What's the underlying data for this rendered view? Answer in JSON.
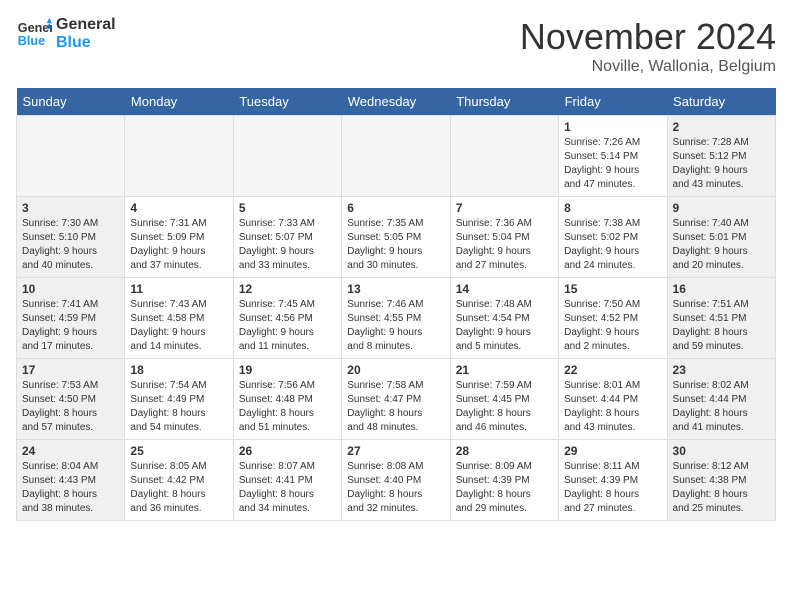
{
  "logo": {
    "line1": "General",
    "line2": "Blue"
  },
  "title": "November 2024",
  "location": "Noville, Wallonia, Belgium",
  "days_of_week": [
    "Sunday",
    "Monday",
    "Tuesday",
    "Wednesday",
    "Thursday",
    "Friday",
    "Saturday"
  ],
  "weeks": [
    [
      {
        "day": "",
        "info": ""
      },
      {
        "day": "",
        "info": ""
      },
      {
        "day": "",
        "info": ""
      },
      {
        "day": "",
        "info": ""
      },
      {
        "day": "",
        "info": ""
      },
      {
        "day": "1",
        "info": "Sunrise: 7:26 AM\nSunset: 5:14 PM\nDaylight: 9 hours\nand 47 minutes."
      },
      {
        "day": "2",
        "info": "Sunrise: 7:28 AM\nSunset: 5:12 PM\nDaylight: 9 hours\nand 43 minutes."
      }
    ],
    [
      {
        "day": "3",
        "info": "Sunrise: 7:30 AM\nSunset: 5:10 PM\nDaylight: 9 hours\nand 40 minutes."
      },
      {
        "day": "4",
        "info": "Sunrise: 7:31 AM\nSunset: 5:09 PM\nDaylight: 9 hours\nand 37 minutes."
      },
      {
        "day": "5",
        "info": "Sunrise: 7:33 AM\nSunset: 5:07 PM\nDaylight: 9 hours\nand 33 minutes."
      },
      {
        "day": "6",
        "info": "Sunrise: 7:35 AM\nSunset: 5:05 PM\nDaylight: 9 hours\nand 30 minutes."
      },
      {
        "day": "7",
        "info": "Sunrise: 7:36 AM\nSunset: 5:04 PM\nDaylight: 9 hours\nand 27 minutes."
      },
      {
        "day": "8",
        "info": "Sunrise: 7:38 AM\nSunset: 5:02 PM\nDaylight: 9 hours\nand 24 minutes."
      },
      {
        "day": "9",
        "info": "Sunrise: 7:40 AM\nSunset: 5:01 PM\nDaylight: 9 hours\nand 20 minutes."
      }
    ],
    [
      {
        "day": "10",
        "info": "Sunrise: 7:41 AM\nSunset: 4:59 PM\nDaylight: 9 hours\nand 17 minutes."
      },
      {
        "day": "11",
        "info": "Sunrise: 7:43 AM\nSunset: 4:58 PM\nDaylight: 9 hours\nand 14 minutes."
      },
      {
        "day": "12",
        "info": "Sunrise: 7:45 AM\nSunset: 4:56 PM\nDaylight: 9 hours\nand 11 minutes."
      },
      {
        "day": "13",
        "info": "Sunrise: 7:46 AM\nSunset: 4:55 PM\nDaylight: 9 hours\nand 8 minutes."
      },
      {
        "day": "14",
        "info": "Sunrise: 7:48 AM\nSunset: 4:54 PM\nDaylight: 9 hours\nand 5 minutes."
      },
      {
        "day": "15",
        "info": "Sunrise: 7:50 AM\nSunset: 4:52 PM\nDaylight: 9 hours\nand 2 minutes."
      },
      {
        "day": "16",
        "info": "Sunrise: 7:51 AM\nSunset: 4:51 PM\nDaylight: 8 hours\nand 59 minutes."
      }
    ],
    [
      {
        "day": "17",
        "info": "Sunrise: 7:53 AM\nSunset: 4:50 PM\nDaylight: 8 hours\nand 57 minutes."
      },
      {
        "day": "18",
        "info": "Sunrise: 7:54 AM\nSunset: 4:49 PM\nDaylight: 8 hours\nand 54 minutes."
      },
      {
        "day": "19",
        "info": "Sunrise: 7:56 AM\nSunset: 4:48 PM\nDaylight: 8 hours\nand 51 minutes."
      },
      {
        "day": "20",
        "info": "Sunrise: 7:58 AM\nSunset: 4:47 PM\nDaylight: 8 hours\nand 48 minutes."
      },
      {
        "day": "21",
        "info": "Sunrise: 7:59 AM\nSunset: 4:45 PM\nDaylight: 8 hours\nand 46 minutes."
      },
      {
        "day": "22",
        "info": "Sunrise: 8:01 AM\nSunset: 4:44 PM\nDaylight: 8 hours\nand 43 minutes."
      },
      {
        "day": "23",
        "info": "Sunrise: 8:02 AM\nSunset: 4:44 PM\nDaylight: 8 hours\nand 41 minutes."
      }
    ],
    [
      {
        "day": "24",
        "info": "Sunrise: 8:04 AM\nSunset: 4:43 PM\nDaylight: 8 hours\nand 38 minutes."
      },
      {
        "day": "25",
        "info": "Sunrise: 8:05 AM\nSunset: 4:42 PM\nDaylight: 8 hours\nand 36 minutes."
      },
      {
        "day": "26",
        "info": "Sunrise: 8:07 AM\nSunset: 4:41 PM\nDaylight: 8 hours\nand 34 minutes."
      },
      {
        "day": "27",
        "info": "Sunrise: 8:08 AM\nSunset: 4:40 PM\nDaylight: 8 hours\nand 32 minutes."
      },
      {
        "day": "28",
        "info": "Sunrise: 8:09 AM\nSunset: 4:39 PM\nDaylight: 8 hours\nand 29 minutes."
      },
      {
        "day": "29",
        "info": "Sunrise: 8:11 AM\nSunset: 4:39 PM\nDaylight: 8 hours\nand 27 minutes."
      },
      {
        "day": "30",
        "info": "Sunrise: 8:12 AM\nSunset: 4:38 PM\nDaylight: 8 hours\nand 25 minutes."
      }
    ]
  ]
}
